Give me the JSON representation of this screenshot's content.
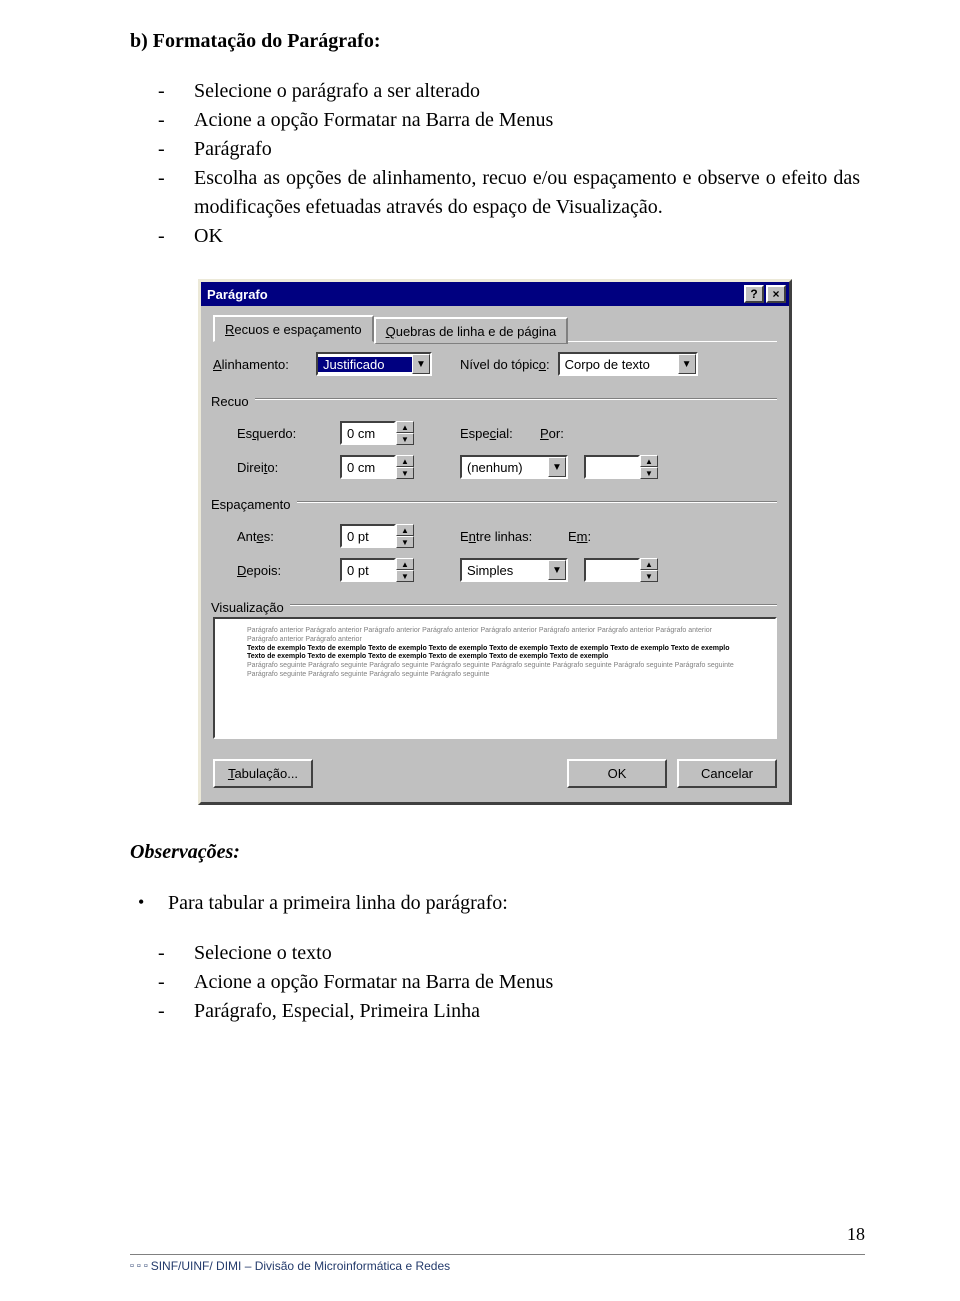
{
  "section_title": "b) Formatação do Parágrafo:",
  "instructions": [
    "Selecione o parágrafo a ser alterado",
    "Acione a opção Formatar na Barra de Menus",
    "Parágrafo",
    "Escolha as opções de alinhamento, recuo e/ou espaçamento e observe o efeito das modificações efetuadas através do espaço de Visualização.",
    "OK"
  ],
  "dialog": {
    "title": "Parágrafo",
    "help": "?",
    "close": "×",
    "tabs": {
      "active": "Recuos e espaçamento",
      "inactive": "Quebras de linha e de página"
    },
    "align_lbl": "Alinhamento:",
    "align_val": "Justificado",
    "nivel_lbl": "Nível do tópico:",
    "nivel_val": "Corpo de texto",
    "recuo_grp": "Recuo",
    "esq_lbl": "Esquerdo:",
    "esq_val": "0 cm",
    "especial_lbl": "Especial:",
    "especial_val": "(nenhum)",
    "por_lbl": "Por:",
    "por_val": "",
    "dir_lbl": "Direito:",
    "dir_val": "0 cm",
    "esp_grp": "Espaçamento",
    "antes_lbl": "Antes:",
    "antes_val": "0 pt",
    "entre_lbl": "Entre linhas:",
    "entre_val": "Simples",
    "em_lbl": "Em:",
    "em_val": "",
    "depois_lbl": "Depois:",
    "depois_val": "0 pt",
    "vis_grp": "Visualização",
    "preview_gray1": "Parágrafo anterior Parágrafo anterior Parágrafo anterior Parágrafo anterior Parágrafo anterior Parágrafo anterior Parágrafo anterior Parágrafo anterior Parágrafo anterior Parágrafo anterior",
    "preview_bold": "Texto de exemplo Texto de exemplo Texto de exemplo Texto de exemplo Texto de exemplo Texto de exemplo Texto de exemplo Texto de exemplo Texto de exemplo Texto de exemplo Texto de exemplo Texto de exemplo Texto de exemplo Texto de exemplo",
    "preview_gray2": "Parágrafo seguinte Parágrafo seguinte Parágrafo seguinte Parágrafo seguinte Parágrafo seguinte Parágrafo seguinte Parágrafo seguinte Parágrafo seguinte Parágrafo seguinte Parágrafo seguinte Parágrafo seguinte Parágrafo seguinte",
    "tab_btn": "Tabulação...",
    "ok_btn": "OK",
    "cancel_btn": "Cancelar"
  },
  "obs": {
    "title": "Observações:",
    "bullet": "Para tabular a primeira linha do parágrafo:",
    "steps": [
      "Selecione o texto",
      "Acione a opção Formatar na Barra de Menus",
      "Parágrafo, Especial, Primeira Linha"
    ]
  },
  "footer": "SINF/UINF/ DIMI – Divisão de Microinformática e Redes",
  "page_num": "18"
}
